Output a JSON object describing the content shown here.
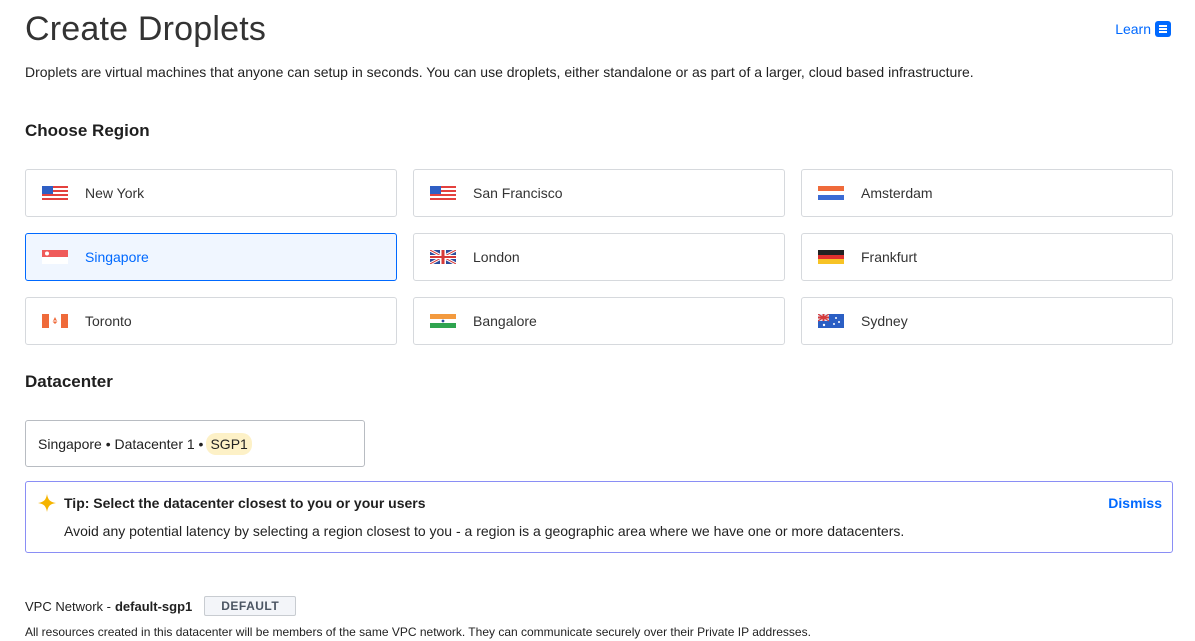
{
  "header": {
    "title": "Create Droplets",
    "learn_label": "Learn",
    "intro": "Droplets are virtual machines that anyone can setup in seconds. You can use droplets, either standalone or as part of a larger, cloud based infrastructure."
  },
  "region": {
    "heading": "Choose Region",
    "items": [
      {
        "label": "New York",
        "flag": "us-flag-icon",
        "selected": false
      },
      {
        "label": "San Francisco",
        "flag": "us-flag-icon",
        "selected": false
      },
      {
        "label": "Amsterdam",
        "flag": "netherlands-flag-icon",
        "selected": false
      },
      {
        "label": "Singapore",
        "flag": "singapore-flag-icon",
        "selected": true
      },
      {
        "label": "London",
        "flag": "uk-flag-icon",
        "selected": false
      },
      {
        "label": "Frankfurt",
        "flag": "germany-flag-icon",
        "selected": false
      },
      {
        "label": "Toronto",
        "flag": "canada-flag-icon",
        "selected": false
      },
      {
        "label": "Bangalore",
        "flag": "india-flag-icon",
        "selected": false
      },
      {
        "label": "Sydney",
        "flag": "australia-flag-icon",
        "selected": false
      }
    ]
  },
  "datacenter": {
    "heading": "Datacenter",
    "selected_prefix": "Singapore • Datacenter 1 •",
    "selected_code": "SGP1"
  },
  "tip": {
    "title": "Tip: Select the datacenter closest to you or your users",
    "body": "Avoid any potential latency by selecting a region closest to you - a region is a geographic area where we have one or more datacenters.",
    "dismiss_label": "Dismiss"
  },
  "vpc": {
    "label": "VPC Network -",
    "name": "default-sgp1",
    "badge": "DEFAULT",
    "description": "All resources created in this datacenter will be members of the same VPC network. They can communicate securely over their Private IP addresses."
  },
  "colors": {
    "accent": "#0069ff",
    "selected_bg": "#f0f6ff",
    "tip_border": "#8a8ef5",
    "highlight": "#fdf1c7"
  }
}
